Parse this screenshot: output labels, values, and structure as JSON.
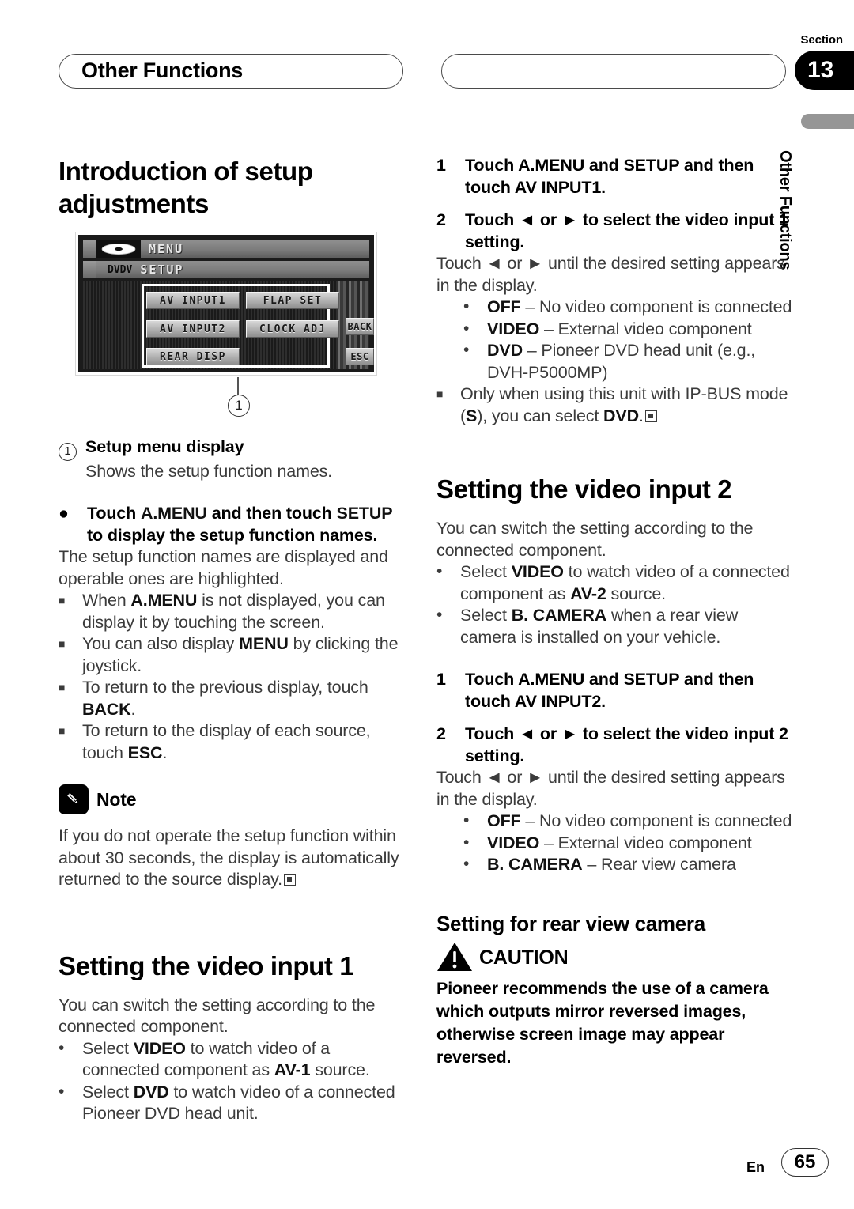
{
  "header": {
    "left_pill_label": "Other Functions",
    "right_pill_label": "",
    "section_word": "Section",
    "section_number": "13",
    "running_head": "Other Functions"
  },
  "footer": {
    "language": "En",
    "page_number": "65"
  },
  "left_column": {
    "title": "Introduction of setup adjustments",
    "figure": {
      "lcd": {
        "menu_label": "MENU",
        "disc_icon": "disc-icon",
        "source_badge": "DVDV",
        "setup_label": "SETUP",
        "keys": [
          "AV  INPUT1",
          "FLAP  SET",
          "AV  INPUT2",
          "CLOCK  ADJ",
          "REAR  DISP"
        ],
        "back_key": "BACK",
        "esc_key": "ESC"
      },
      "callout_number": "1"
    },
    "callout": {
      "number": "1",
      "title": "Setup menu display",
      "description": "Shows the setup function names."
    },
    "bullet_heading_mark": "●",
    "bullet_heading": "Touch A.MENU and then touch SETUP to display the setup function names.",
    "bullet_body": "The setup function names are displayed and operable ones are highlighted.",
    "notes_squares": [
      "When A.MENU is not displayed, you can display it by touching the screen.",
      "You can also display MENU by clicking the joystick.",
      "To return to the previous display, touch BACK.",
      "To return to the display of each source, touch ESC."
    ],
    "note_block": {
      "icon": "pencil-icon",
      "title": "Note",
      "text": "If you do not operate the setup function within about 30 seconds, the display is automatically returned to the source display."
    },
    "video_input_1": {
      "title": "Setting the video input 1",
      "intro": "You can switch the setting according to the connected component.",
      "bullets": [
        "Select VIDEO to watch video of a connected component as AV-1 source.",
        "Select DVD to watch video of a connected Pioneer DVD head unit."
      ]
    }
  },
  "right_column": {
    "steps_input1": [
      {
        "number": "1",
        "text": "Touch A.MENU and SETUP and then touch AV INPUT1."
      },
      {
        "number": "2",
        "text": "Touch ◄ or ► to select the video input 1 setting.",
        "body": "Touch ◄ or ► until the desired setting appears in the display.",
        "options": [
          {
            "name": "OFF",
            "desc": "– No video component is connected"
          },
          {
            "name": "VIDEO",
            "desc": "– External video component"
          },
          {
            "name": "DVD",
            "desc": "– Pioneer DVD head unit (e.g., DVH-P5000MP)"
          }
        ],
        "note": "Only when using this unit with IP-BUS mode (S), you can select DVD."
      }
    ],
    "video_input_2": {
      "title": "Setting the video input 2",
      "intro": "You can switch the setting according to the connected component.",
      "bullets": [
        "Select VIDEO to watch video of a connected component as AV-2 source.",
        "Select B. CAMERA when a rear view camera is installed on your vehicle."
      ],
      "steps": [
        {
          "number": "1",
          "text": "Touch A.MENU and SETUP and then touch AV INPUT2."
        },
        {
          "number": "2",
          "text": "Touch ◄ or ► to select the video input 2 setting.",
          "body": "Touch ◄ or ► until the desired setting appears in the display.",
          "options": [
            {
              "name": "OFF",
              "desc": "– No video component is connected"
            },
            {
              "name": "VIDEO",
              "desc": "– External video component"
            },
            {
              "name": "B. CAMERA",
              "desc": "– Rear view camera"
            }
          ]
        }
      ]
    },
    "rear_view_camera": {
      "title": "Setting for rear view camera",
      "caution_icon": "warning-triangle-icon",
      "caution_title": "CAUTION",
      "caution_text": "Pioneer recommends the use of a camera which outputs mirror reversed images, otherwise screen image may appear reversed."
    }
  }
}
